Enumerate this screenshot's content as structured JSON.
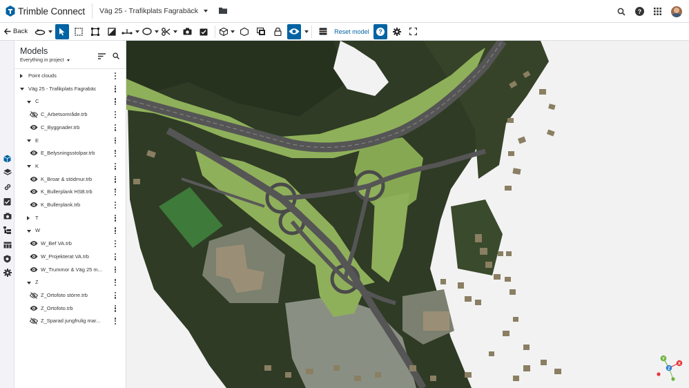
{
  "app": {
    "name": "Trimble Connect"
  },
  "project": {
    "name": "Väg 25 - Trafikplats Fagrabäck"
  },
  "header_icons": [
    "folder-icon",
    "search-icon",
    "help-icon",
    "apps-grid-icon",
    "user-avatar"
  ],
  "toolbar": {
    "back_label": "Back",
    "reset_label": "Reset model",
    "tools": [
      "orbit-icon",
      "select-icon",
      "box-select-icon",
      "area-select-icon",
      "clip-box-icon",
      "measure-icon",
      "markup-ellipse-icon",
      "cut-icon",
      "snapshot-icon",
      "checklist-icon",
      "cube-view-icon",
      "ghost-icon",
      "layers-view-icon",
      "lock-icon",
      "visibility-icon",
      "grid-icon",
      "help-active-icon",
      "settings-icon",
      "fullscreen-icon"
    ]
  },
  "colors": {
    "accent": "#0063a3",
    "text": "#252a2e",
    "panel_bg": "#ffffff",
    "rail_bg": "#f3f3f7",
    "ground": "#f2f2f2",
    "terrain": "#8fb05a",
    "forest": "#2f3b25",
    "road": "#555555"
  },
  "rail": {
    "icons": [
      "model-cube-icon",
      "layers-icon",
      "link-icon",
      "todo-icon",
      "camera-icon",
      "hierarchy-icon",
      "table-icon",
      "shield-icon",
      "gear-icon"
    ]
  },
  "models_panel": {
    "title": "Models",
    "scope": "Everything in project",
    "tree": [
      {
        "type": "folder",
        "label": "Point clouds",
        "level": 0,
        "expanded": false
      },
      {
        "type": "folder",
        "label": "Väg 25 - Trafikplats Fagrabäck",
        "level": 0,
        "expanded": true
      },
      {
        "type": "folder",
        "label": "C",
        "level": 1,
        "expanded": true
      },
      {
        "type": "file",
        "label": "C_Arbetsområde.trb",
        "visible": false
      },
      {
        "type": "file",
        "label": "C_Byggnader.trb",
        "visible": true
      },
      {
        "type": "folder",
        "label": "E",
        "level": 1,
        "expanded": true
      },
      {
        "type": "file",
        "label": "E_Belysningsstolpar.trb",
        "visible": true
      },
      {
        "type": "folder",
        "label": "K",
        "level": 1,
        "expanded": true
      },
      {
        "type": "file",
        "label": "K_Broar & stödmur.trb",
        "visible": true
      },
      {
        "type": "file",
        "label": "K_Bullerplank HSB.trb",
        "visible": true
      },
      {
        "type": "file",
        "label": "K_Bullerplank.trb",
        "visible": true
      },
      {
        "type": "folder",
        "label": "T",
        "level": 1,
        "expanded": false
      },
      {
        "type": "folder",
        "label": "W",
        "level": 1,
        "expanded": true
      },
      {
        "type": "file",
        "label": "W_Bef VA.trb",
        "visible": true
      },
      {
        "type": "file",
        "label": "W_Projekterat VA.trb",
        "visible": true
      },
      {
        "type": "file",
        "label": "W_Trummor & Väg 25 m...",
        "visible": true
      },
      {
        "type": "folder",
        "label": "Z",
        "level": 1,
        "expanded": true
      },
      {
        "type": "file",
        "label": "Z_Ortofoto större.trb",
        "visible": false
      },
      {
        "type": "file",
        "label": "Z_Ortofoto.trb",
        "visible": true
      },
      {
        "type": "file",
        "label": "Z_Sparad jungfrulig mar...",
        "visible": false
      }
    ]
  },
  "viewcube": {
    "x_label": "X",
    "y_label": "Y",
    "z_label": "Z",
    "x_color": "#e8353a",
    "y_color": "#6cb33f",
    "z_color": "#2f7fd0"
  }
}
